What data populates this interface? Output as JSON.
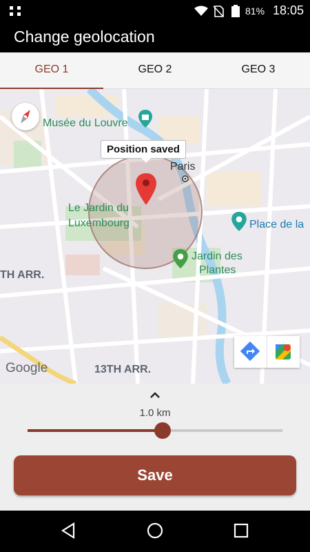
{
  "status_bar": {
    "battery_pct": "81%",
    "time": "18:05"
  },
  "app_bar": {
    "title": "Change geolocation"
  },
  "tabs": [
    {
      "label": "GEO 1",
      "active": true
    },
    {
      "label": "GEO 2",
      "active": false
    },
    {
      "label": "GEO 3",
      "active": false
    }
  ],
  "map": {
    "tooltip": "Position saved",
    "labels": {
      "louvre": "Musée du Louvre",
      "paris": "Paris",
      "jardin_lux_1": "Le Jardin du",
      "jardin_lux_2": "Luxembourg",
      "place_de_la": "Place de la",
      "jardin_plantes_1": "Jardin des",
      "jardin_plantes_2": "Plantes",
      "arr_left": "TH ARR.",
      "arr_13": "13TH ARR.",
      "google": "Google"
    }
  },
  "controls": {
    "distance": "1.0 km",
    "slider_fraction": 0.53,
    "save_label": "Save"
  },
  "colors": {
    "accent": "#8b3a2b",
    "button": "#9b4534",
    "pin": "#e53935"
  }
}
